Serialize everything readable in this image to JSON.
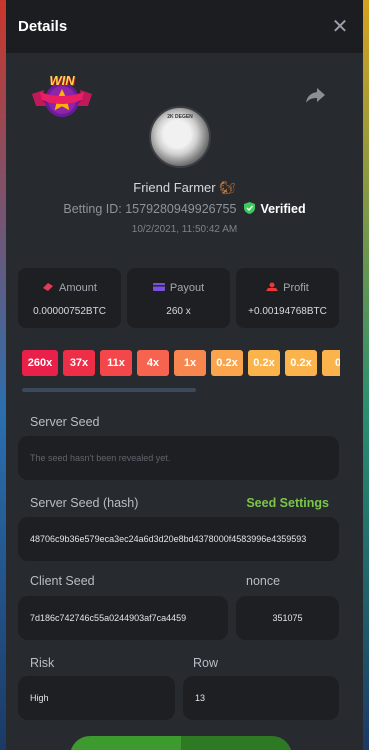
{
  "header": {
    "title": "Details"
  },
  "badge": {
    "text": "WIN"
  },
  "user": {
    "name": "Friend Farmer",
    "avatar_caption": "2K DEGEN",
    "betting_id_label": "Betting ID: 1579280949926755",
    "verified_label": "Verified",
    "timestamp": "10/2/2021, 11:50:42 AM"
  },
  "stats": {
    "amount": {
      "label": "Amount",
      "value": "0.00000752BTC"
    },
    "payout": {
      "label": "Payout",
      "value": "260 x"
    },
    "profit": {
      "label": "Profit",
      "value": "+0.00194768BTC"
    }
  },
  "multipliers": [
    {
      "label": "260x",
      "color": "#e8204a"
    },
    {
      "label": "37x",
      "color": "#ee2d47"
    },
    {
      "label": "11x",
      "color": "#f3474b"
    },
    {
      "label": "4x",
      "color": "#f66450"
    },
    {
      "label": "1x",
      "color": "#f8874f"
    },
    {
      "label": "0.2x",
      "color": "#faa54e"
    },
    {
      "label": "0.2x",
      "color": "#fbb34c"
    },
    {
      "label": "0.2x",
      "color": "#fbb34c"
    },
    {
      "label": "0",
      "color": "#fbb34c"
    }
  ],
  "server_seed": {
    "label": "Server Seed",
    "placeholder": "The seed hasn't been revealed yet."
  },
  "server_seed_hash": {
    "label": "Server Seed (hash)",
    "settings_label": "Seed Settings",
    "value": "48706c9b36e579eca3ec24a6d3d20e8bd4378000f4583996e4359593"
  },
  "client_seed": {
    "label": "Client Seed",
    "value": "7d186c742746c55a0244903af7ca4459"
  },
  "nonce": {
    "label": "nonce",
    "value": "351075"
  },
  "risk": {
    "label": "Risk",
    "value": "High"
  },
  "row": {
    "label": "Row",
    "value": "13"
  },
  "icons": [
    "close-icon",
    "share-icon",
    "verified-shield-icon",
    "amount-icon",
    "payout-icon",
    "profit-icon"
  ]
}
